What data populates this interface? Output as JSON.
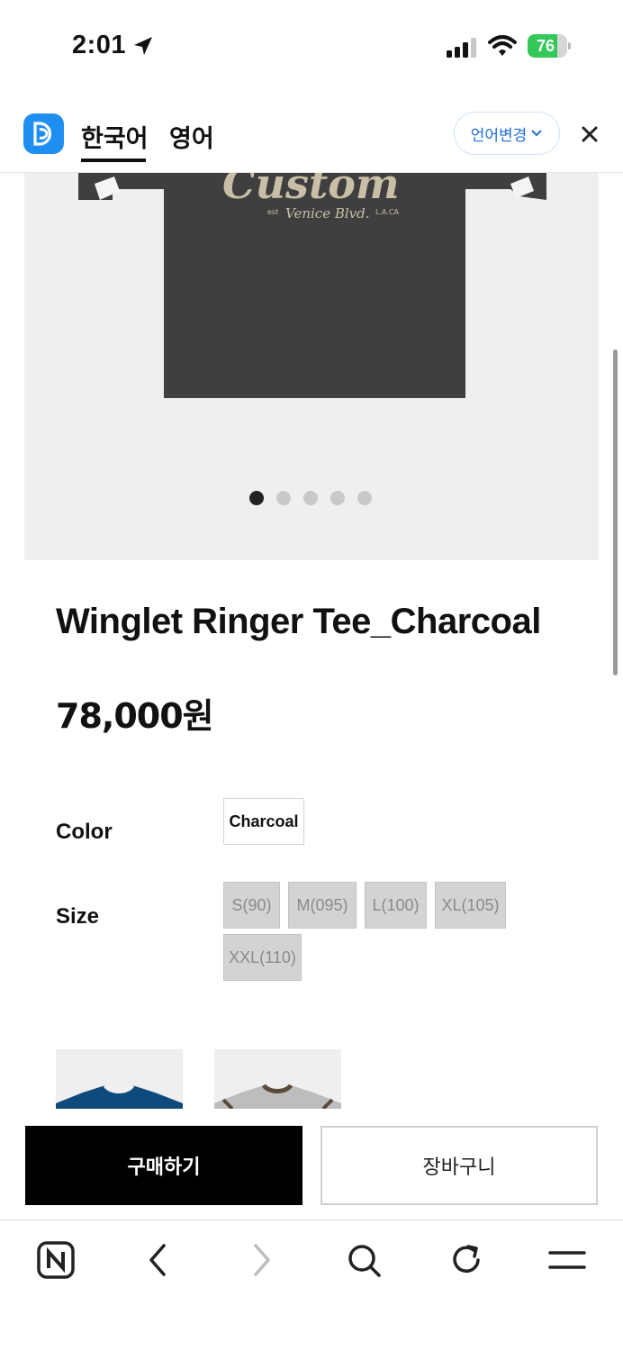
{
  "status_bar": {
    "time": "2:01",
    "battery_percent": "76",
    "battery_level": 0.76,
    "icons": [
      "location-arrow-icon",
      "signal-icon",
      "wifi-icon",
      "battery-charging-icon"
    ]
  },
  "translate_bar": {
    "logo_icon": "translate-app-logo",
    "tabs": [
      {
        "label": "한국어",
        "active": true
      },
      {
        "label": "영어",
        "active": false
      }
    ],
    "change_language_label": "언어변경",
    "close_icon": "close-icon"
  },
  "gallery": {
    "image_alt_icon": "tshirt-image",
    "dots_total": 5,
    "dots_active_index": 0
  },
  "product": {
    "title": "Winglet Ringer Tee_Charcoal",
    "price": "78,000원",
    "color_label": "Color",
    "colors": [
      "Charcoal"
    ],
    "size_label": "Size",
    "sizes": [
      "S(90)",
      "M(095)",
      "L(100)",
      "XL(105)",
      "XXL(110)"
    ]
  },
  "actions": {
    "buy_label": "구매하기",
    "cart_label": "장바구니"
  },
  "browser_toolbar": {
    "icons": [
      "naver-home-icon",
      "back-icon",
      "forward-icon",
      "search-icon",
      "reload-icon",
      "menu-icon"
    ]
  },
  "colors": {
    "accent_blue": "#1f8ef1",
    "battery_green": "#34c759",
    "buy_button": "#000000",
    "shirt_charcoal": "#3f3f3f"
  }
}
